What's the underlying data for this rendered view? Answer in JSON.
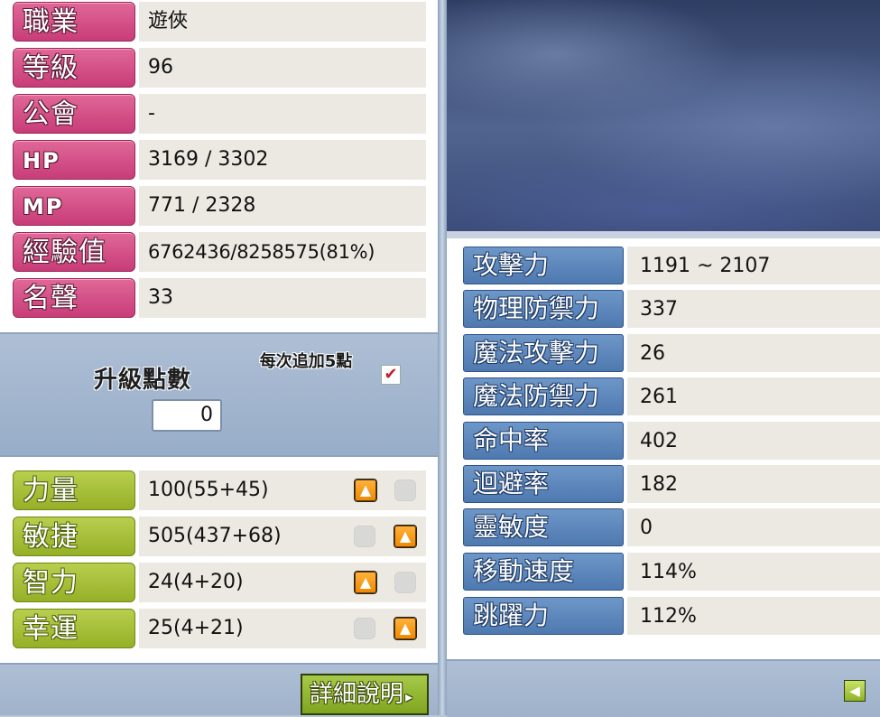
{
  "profile": {
    "rows": [
      {
        "label": "職業",
        "value": "遊俠"
      },
      {
        "label": "等級",
        "value": "96"
      },
      {
        "label": "公會",
        "value": "-"
      },
      {
        "label": "HP",
        "value": "3169 / 3302"
      },
      {
        "label": "MP",
        "value": "771 / 2328"
      },
      {
        "label": "經驗值",
        "value": "6762436/8258575(81%)"
      },
      {
        "label": "名聲",
        "value": "33"
      }
    ]
  },
  "level_up": {
    "label": "升級點數",
    "points": "0",
    "add_per_label": "每次追加5點",
    "add_per_checked": true,
    "check_glyph": "✔"
  },
  "attributes": [
    {
      "label": "力量",
      "value": "100(55+45)",
      "up_enabled_first": true
    },
    {
      "label": "敏捷",
      "value": "505(437+68)",
      "up_enabled_first": false
    },
    {
      "label": "智力",
      "value": "24(4+20)",
      "up_enabled_first": true
    },
    {
      "label": "幸運",
      "value": "25(4+21)",
      "up_enabled_first": false
    }
  ],
  "detail_button": {
    "label": "詳細說明",
    "arrow": "▸"
  },
  "stats": [
    {
      "label": "攻擊力",
      "value": "1191 ~ 2107"
    },
    {
      "label": "物理防禦力",
      "value": "337"
    },
    {
      "label": "魔法攻擊力",
      "value": "26"
    },
    {
      "label": "魔法防禦力",
      "value": "261"
    },
    {
      "label": "命中率",
      "value": "402"
    },
    {
      "label": "迴避率",
      "value": "182"
    },
    {
      "label": "靈敏度",
      "value": "0"
    },
    {
      "label": "移動速度",
      "value": "114%"
    },
    {
      "label": "跳躍力",
      "value": "112%"
    }
  ],
  "icons": {
    "up_arrow": "▲",
    "back_arrow": "◀"
  },
  "colors": {
    "profile_tag": "#c83c78",
    "attribute_tag": "#95b027",
    "stat_tag": "#4e79b0",
    "up_button": "#f08a00"
  }
}
